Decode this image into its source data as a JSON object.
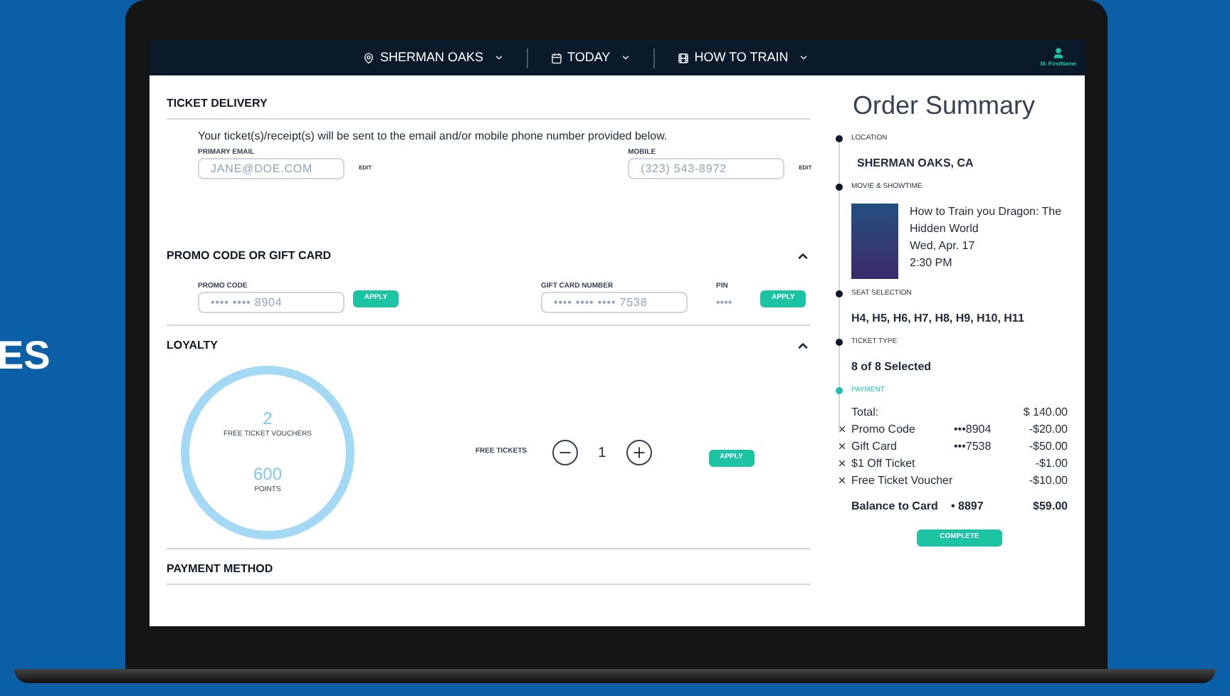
{
  "side_text": "ES",
  "nav": {
    "items": [
      {
        "kind": "location",
        "label": "SHERMAN OAKS"
      },
      {
        "kind": "calendar",
        "label": "TODAY"
      },
      {
        "kind": "film",
        "label": "HOW TO TRAIN"
      }
    ],
    "user": "M. FirstName"
  },
  "ticket_delivery": {
    "title": "TICKET DELIVERY",
    "note": "Your ticket(s)/receipt(s) will be sent to the email and/or mobile phone number provided below.",
    "email": {
      "label": "PRIMARY EMAIL",
      "value": "JANE@DOE.COM",
      "action": "EDIT"
    },
    "mobile": {
      "label": "MOBILE",
      "value": "(323) 543-8972",
      "action": "EDIT"
    }
  },
  "promo": {
    "title": "PROMO CODE OR GIFT CARD",
    "expanded": true,
    "promo_code": {
      "label": "PROMO CODE",
      "value": "•••• •••• 8904",
      "action": "APPLY"
    },
    "gift_card": {
      "label": "GIFT CARD NUMBER",
      "value": "•••• •••• •••• 7538"
    },
    "pin": {
      "label": "PIN",
      "value": "••••",
      "action": "APPLY"
    }
  },
  "loyalty": {
    "title": "LOYALTY",
    "expanded": true,
    "vouchers": "2",
    "vouchers_label": "FREE TICKET VOUCHERS",
    "points": "600",
    "points_label": "POINTS",
    "free_tickets_label": "FREE TICKETS",
    "count": "1",
    "action": "APPLY"
  },
  "payment_method": {
    "title": "PAYMENT METHOD"
  },
  "summary": {
    "title": "Order Summary",
    "steps": [
      {
        "label": "LOCATION",
        "active": false,
        "lines": [
          "SHERMAN OAKS, CA"
        ]
      },
      {
        "label": "MOVIE & SHOWTIME",
        "active": false,
        "kind": "movie",
        "lines": [
          "How to Train you Dragon: The Hidden World",
          "Wed, Apr. 17",
          "2:30 PM"
        ]
      },
      {
        "label": "SEAT SELECTION",
        "active": false,
        "lines": [
          "H4, H5, H6, H7, H8, H9, H10, H11"
        ]
      },
      {
        "label": "TICKET TYPE",
        "active": false,
        "lines": [
          "8 of 8 Selected"
        ]
      },
      {
        "label": "PAYMENT",
        "active": true
      }
    ],
    "total": {
      "label": "Total:",
      "amount": "$ 140.00"
    },
    "discounts": [
      {
        "label": "Promo Code",
        "card": "•••8904",
        "amount": "-$20.00"
      },
      {
        "label": "Gift Card",
        "card": "•••7538",
        "amount": "-$50.00"
      },
      {
        "label": "$1 Off Ticket",
        "amount": "-$1.00"
      },
      {
        "label": "Free Ticket Voucher",
        "amount": "-$10.00"
      }
    ],
    "balance": {
      "label": "Balance to Card",
      "card": "• 8897",
      "amount": "$59.00"
    },
    "action": "COMPLETE"
  }
}
